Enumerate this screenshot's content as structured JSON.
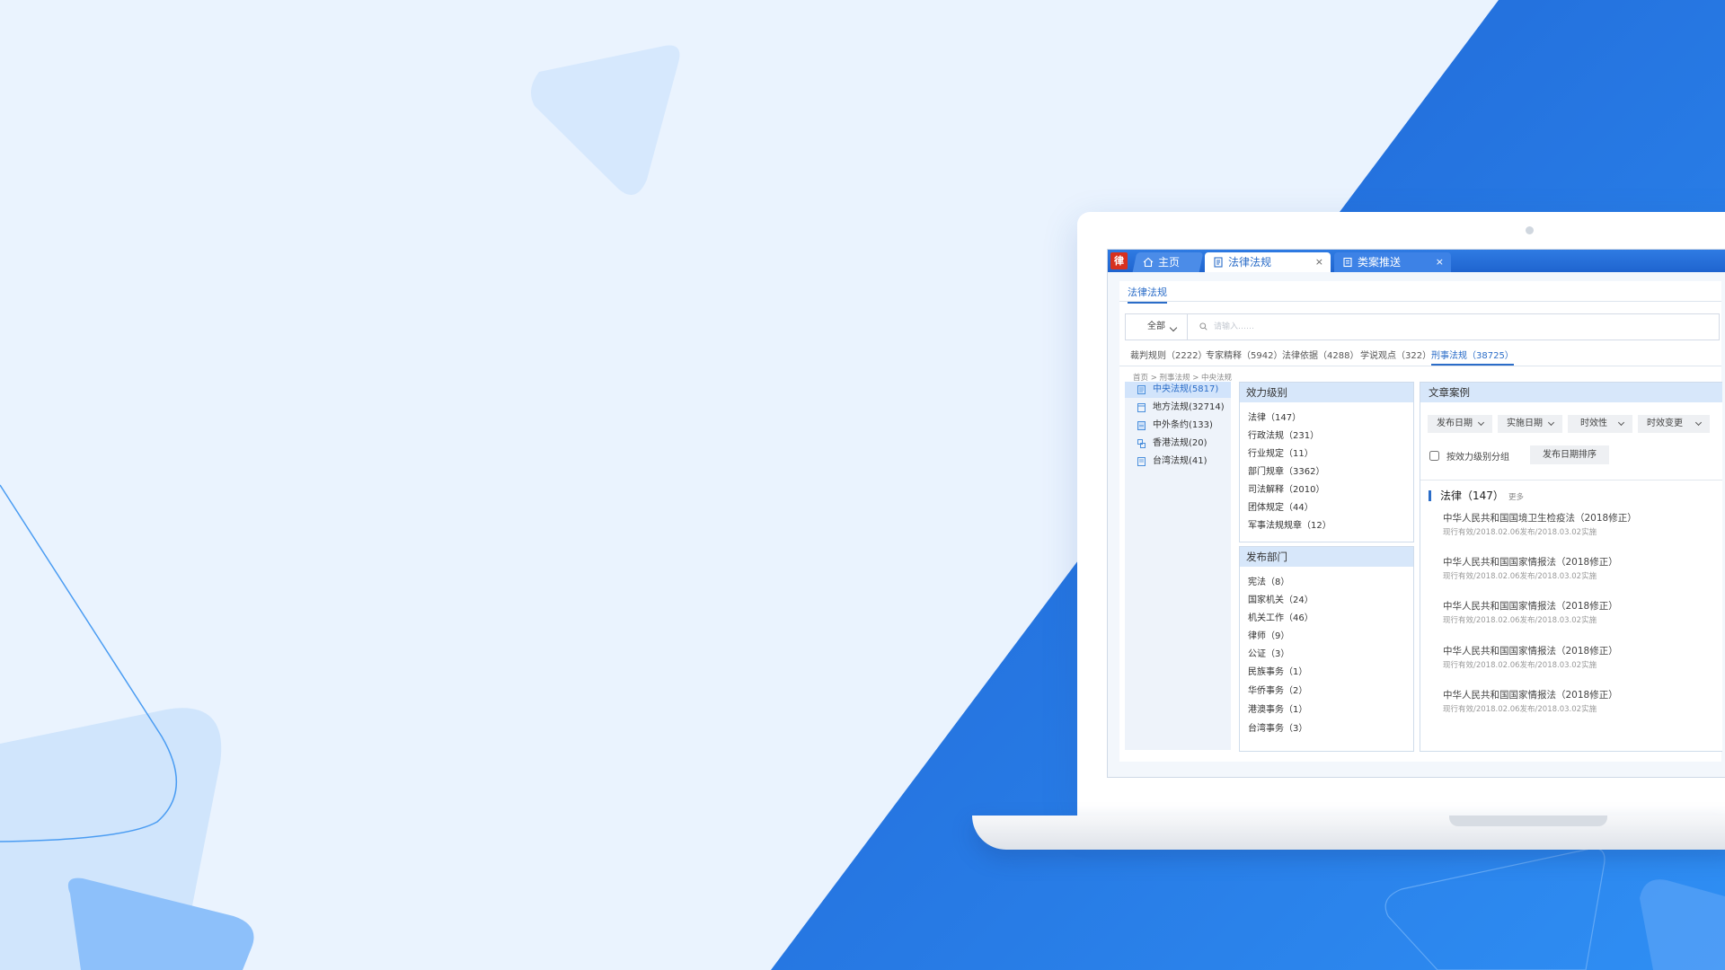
{
  "colors": {
    "background": "#eaf3fe",
    "blue_panel": "#2a86f0",
    "accent": "#2b6dc8",
    "logo_red": "#d7311f"
  },
  "app": {
    "logo_icon": "law-firm-logo",
    "logo_text": "律",
    "tabs": [
      {
        "label": "主页",
        "icon": "home-icon"
      },
      {
        "label": "法律法规",
        "icon": "document-icon",
        "close": "×"
      },
      {
        "label": "类案推送",
        "icon": "case-icon",
        "close": "×"
      }
    ]
  },
  "page_tab": "法律法规",
  "search": {
    "scope": "全部",
    "placeholder": "请输入……"
  },
  "categories": [
    "裁判规则（2222）",
    "专家精释（5942）",
    "法律依据（4288）",
    "学说观点（322）",
    "刑事法规（38725）"
  ],
  "breadcrumb": "首页 > 刑事法规 > 中央法规",
  "left_nav": [
    {
      "label": "中央法规(5817)",
      "icon": "central-law-icon"
    },
    {
      "label": "地方法规(32714)",
      "icon": "local-law-icon"
    },
    {
      "label": "中外条约(133)",
      "icon": "treaty-icon"
    },
    {
      "label": "香港法规(20)",
      "icon": "hk-law-icon"
    },
    {
      "label": "台湾法规(41)",
      "icon": "tw-law-icon"
    }
  ],
  "facets": {
    "level": {
      "title": "效力级别",
      "items": [
        "法律（147）",
        "行政法规（231）",
        "行业规定（11）",
        "部门规章（3362）",
        "司法解释（2010）",
        "团体规定（44）",
        "军事法规规章（12）"
      ]
    },
    "dept": {
      "title": "发布部门",
      "items": [
        "宪法（8）",
        "国家机关（24）",
        "机关工作（46）",
        "律师（9）",
        "公证（3）",
        "民族事务（1）",
        "华侨事务（2）",
        "港澳事务（1）",
        "台湾事务（3）"
      ]
    }
  },
  "results": {
    "title": "文章案例",
    "filters": [
      "发布日期",
      "实施日期",
      "时效性",
      "时效变更"
    ],
    "group_label": "按效力级别分组",
    "sort_button": "发布日期排序",
    "section_title": "法律（147）",
    "more": "更多",
    "items": [
      {
        "title": "中华人民共和国国境卫生检疫法（2018修正）",
        "meta": "现行有效/2018.02.06发布/2018.03.02实施"
      },
      {
        "title": "中华人民共和国国家情报法（2018修正）",
        "meta": "现行有效/2018.02.06发布/2018.03.02实施"
      },
      {
        "title": "中华人民共和国国家情报法（2018修正）",
        "meta": "现行有效/2018.02.06发布/2018.03.02实施"
      },
      {
        "title": "中华人民共和国国家情报法（2018修正）",
        "meta": "现行有效/2018.02.06发布/2018.03.02实施"
      },
      {
        "title": "中华人民共和国国家情报法（2018修正）",
        "meta": "现行有效/2018.02.06发布/2018.03.02实施"
      }
    ]
  }
}
